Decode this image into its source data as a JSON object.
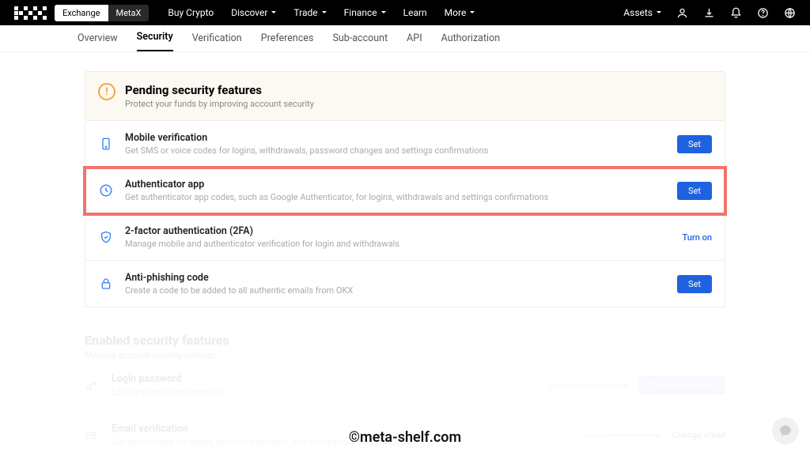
{
  "topnav": {
    "pill": {
      "exchange": "Exchange",
      "metax": "MetaX"
    },
    "links": [
      "Buy Crypto",
      "Discover",
      "Trade",
      "Finance",
      "Learn",
      "More"
    ],
    "link_has_chev": [
      false,
      true,
      true,
      true,
      false,
      true
    ],
    "assets": "Assets"
  },
  "subnav": [
    "Overview",
    "Security",
    "Verification",
    "Preferences",
    "Sub-account",
    "API",
    "Authorization"
  ],
  "subnav_active": 1,
  "pending": {
    "title": "Pending security features",
    "subtitle": "Protect your funds by improving account security",
    "items": [
      {
        "icon": "phone",
        "title": "Mobile verification",
        "desc": "Get SMS or voice codes for logins, withdrawals, password changes and settings confirmations",
        "action": "Set",
        "action_type": "button"
      },
      {
        "icon": "auth",
        "title": "Authenticator app",
        "desc": "Get authenticator app codes, such as Google Authenticator, for logins, withdrawals and settings confirmations",
        "action": "Set",
        "action_type": "button",
        "highlighted": true
      },
      {
        "icon": "shield",
        "title": "2-factor authentication (2FA)",
        "desc": "Manage mobile and authenticator verification for login and withdrawals",
        "action": "Turn on",
        "action_type": "link"
      },
      {
        "icon": "lock",
        "title": "Anti-phishing code",
        "desc": "Create a code to be added to all authentic emails from OKX",
        "action": "Set",
        "action_type": "button"
      }
    ]
  },
  "enabled": {
    "title": "Enabled security features",
    "subtitle": "Manage account security settings",
    "items": [
      {
        "icon": "key",
        "title": "Login password",
        "desc": "Login password has been set",
        "action": "Change Password"
      },
      {
        "icon": "mail",
        "title": "Email verification",
        "desc": "Get email codes for logins, password updates, and withdrawals confirmations",
        "action": "Change email"
      }
    ]
  },
  "watermark": "©meta-shelf.com"
}
